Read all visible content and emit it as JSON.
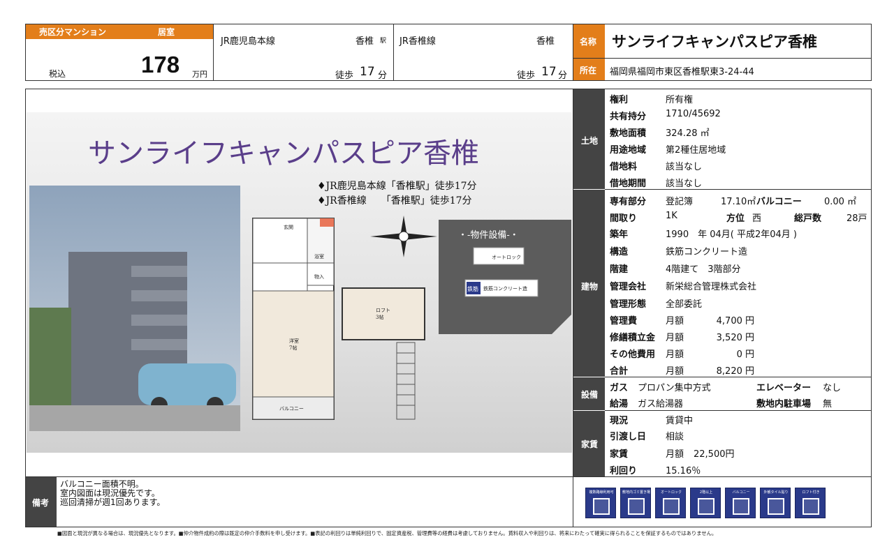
{
  "header": {
    "property_type": "売区分マンション",
    "room_type": "居室",
    "tax_label": "税込",
    "price": "178",
    "price_unit": "万円",
    "line1": "JR鹿児島本線",
    "station1": "香椎",
    "station_suffix": "駅",
    "walk1_pre": "徒歩",
    "walk1_num": "17",
    "walk_unit": "分",
    "line2": "JR香椎線",
    "station2": "香椎",
    "walk2_pre": "徒歩",
    "walk2_num": "17",
    "name_label": "名称",
    "name": "サンライフキャンパスピア香椎",
    "address_label": "所在",
    "address": "福岡県福岡市東区香椎駅東3-24-44"
  },
  "image": {
    "title": "サンライフキャンパスピア香椎",
    "access1": "♦JR鹿児島本線「香椎駅」徒歩17分",
    "access2": "♦JR香椎線　　「香椎駅」徒歩17分",
    "equipment_title": "・-物件設備-・",
    "autolock": "オートロック",
    "rc_badge": "鉄筋",
    "rc": "鉄筋コンクリート造",
    "floor_entrance": "玄関",
    "floor_bath": "浴室",
    "floor_closet": "物入",
    "floor_room": "洋室\n7帖",
    "floor_loft": "ロフト\n3帖",
    "floor_balcony": "バルコニー"
  },
  "land": {
    "section": "土地",
    "rows": [
      {
        "label": "権利",
        "value": "所有権"
      },
      {
        "label": "共有持分",
        "value": "1710/45692"
      },
      {
        "label": "敷地面積",
        "value": "324.28 ㎡"
      },
      {
        "label": "用途地域",
        "value": "第2種住居地域"
      },
      {
        "label": "借地料",
        "value": "該当なし"
      },
      {
        "label": "借地期間",
        "value": "該当なし"
      }
    ]
  },
  "building": {
    "section": "建物",
    "exclusive_label": "専有部分",
    "exclusive_type": "登記簿",
    "exclusive_area": "17.10㎡",
    "balcony_label": "バルコニー",
    "balcony_area": "0.00 ㎡",
    "layout_label": "間取り",
    "layout": "1K",
    "direction_label": "方位",
    "direction": "西",
    "units_label": "総戸数",
    "units": "28戸",
    "built_label": "築年",
    "built": "1990　年 04月( 平成2年04月 )",
    "structure_label": "構造",
    "structure": "鉄筋コンクリート造",
    "floors_label": "階建",
    "floors": "4階建て　3階部分",
    "mgmt_co_label": "管理会社",
    "mgmt_co": "新栄総合管理株式会社",
    "mgmt_type_label": "管理形態",
    "mgmt_type": "全部委託",
    "fees": [
      {
        "label": "管理費",
        "period": "月額",
        "amount": "4,700 円"
      },
      {
        "label": "修繕積立金",
        "period": "月額",
        "amount": "3,520 円"
      },
      {
        "label": "その他費用",
        "period": "月額",
        "amount": "0 円"
      },
      {
        "label": "合計",
        "period": "月額",
        "amount": "8,220 円"
      }
    ]
  },
  "equipment": {
    "section": "設備",
    "gas_label": "ガス",
    "gas": "プロパン集中方式",
    "elevator_label": "エレベーター",
    "elevator": "なし",
    "water_label": "給湯",
    "water": "ガス給湯器",
    "parking_label": "敷地内駐車場",
    "parking": "無"
  },
  "rent": {
    "section": "家賃",
    "status_label": "現況",
    "status": "賃貸中",
    "handover_label": "引渡し日",
    "handover": "相談",
    "rent_label": "家賃",
    "rent_period": "月額",
    "rent_amount": "22,500円",
    "yield_label": "利回り",
    "yield": "15.16％"
  },
  "remarks": {
    "label": "備考",
    "line1": "バルコニー面積不明。",
    "line2": "室内図面は現況優先です。",
    "line3": "巡回清掃が週1回あります。"
  },
  "icons": [
    {
      "caption": "複数路線利用可",
      "name": "multi-line-icon"
    },
    {
      "caption": "敷地内ゴミ置き場",
      "name": "garbage-icon"
    },
    {
      "caption": "オートロック",
      "name": "autolock-icon"
    },
    {
      "caption": "2階以上",
      "name": "upper-floor-icon"
    },
    {
      "caption": "バルコニー",
      "name": "balcony-icon"
    },
    {
      "caption": "外観タイル貼り",
      "name": "tile-icon"
    },
    {
      "caption": "ロフト付き",
      "name": "loft-icon"
    }
  ],
  "footer": "■図面と現況が異なる場合は、現況優先となります。■仲介物件成約の際は既定の仲介手数料を申し受けます。■表記の利回りは単純利回りで、固定資産税、管理費等の経費は考慮しておりません。賃料収入や利回りは、将来にわたって確実に得られることを保証するものではありません。",
  "colors": {
    "accent": "#e37e1a",
    "label_bg": "#444444",
    "purple": "#5a3e8a",
    "red": "#c0392b"
  }
}
